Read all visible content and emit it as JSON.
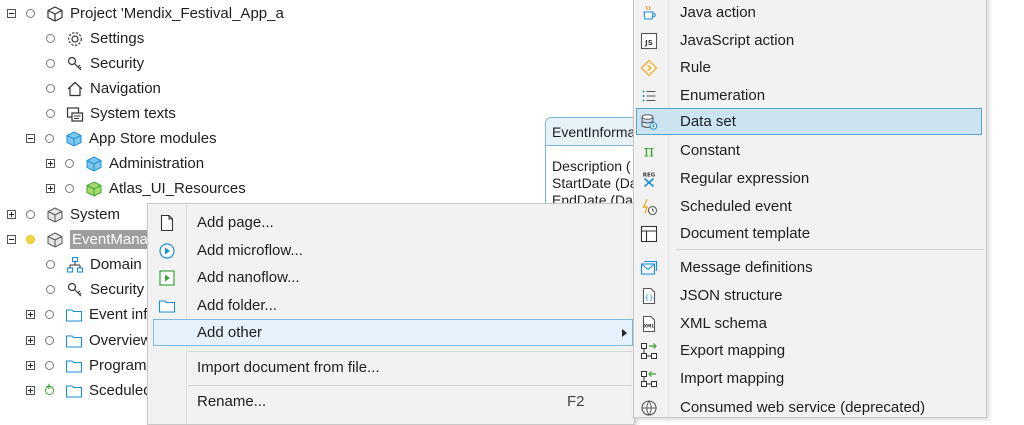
{
  "tree": {
    "project": "Project 'Mendix_Festival_App_a",
    "settings": "Settings",
    "security": "Security",
    "navigation": "Navigation",
    "system_texts": "System texts",
    "app_store_modules": "App Store modules",
    "administration": "Administration",
    "atlas": "Atlas_UI_Resources",
    "system": "System",
    "event_management": "EventManag",
    "domain_model": "Domain",
    "module_security": "Security",
    "event_info": "Event inf",
    "overview": "Overview",
    "program": "Program",
    "scheduled": "Sceduled"
  },
  "entity": {
    "name": "EventInforma",
    "attributes": [
      "Description (",
      "StartDate (Da",
      "EndDate (Da"
    ]
  },
  "context_menu": {
    "add_page": "Add page...",
    "add_microflow": "Add microflow...",
    "add_nanoflow": "Add nanoflow...",
    "add_folder": "Add folder...",
    "add_other": "Add other",
    "import_document": "Import document from file...",
    "rename": "Rename...",
    "rename_shortcut": "F2"
  },
  "submenu": {
    "java_action": "Java action",
    "javascript_action": "JavaScript action",
    "rule": "Rule",
    "enumeration": "Enumeration",
    "data_set": "Data set",
    "constant": "Constant",
    "regular_expression": "Regular expression",
    "scheduled_event": "Scheduled event",
    "document_template": "Document template",
    "message_definitions": "Message definitions",
    "json_structure": "JSON structure",
    "xml_schema": "XML schema",
    "export_mapping": "Export mapping",
    "import_mapping": "Import mapping",
    "consumed_web_service": "Consumed web service (deprecated)"
  },
  "colors": {
    "accent_blue": "#1a8fd6",
    "menu_background": "#f2f2f2",
    "hover_highlight": "#cce4f2",
    "module_yellow": "#f4d442",
    "nanoflow_green": "#3aa534"
  }
}
